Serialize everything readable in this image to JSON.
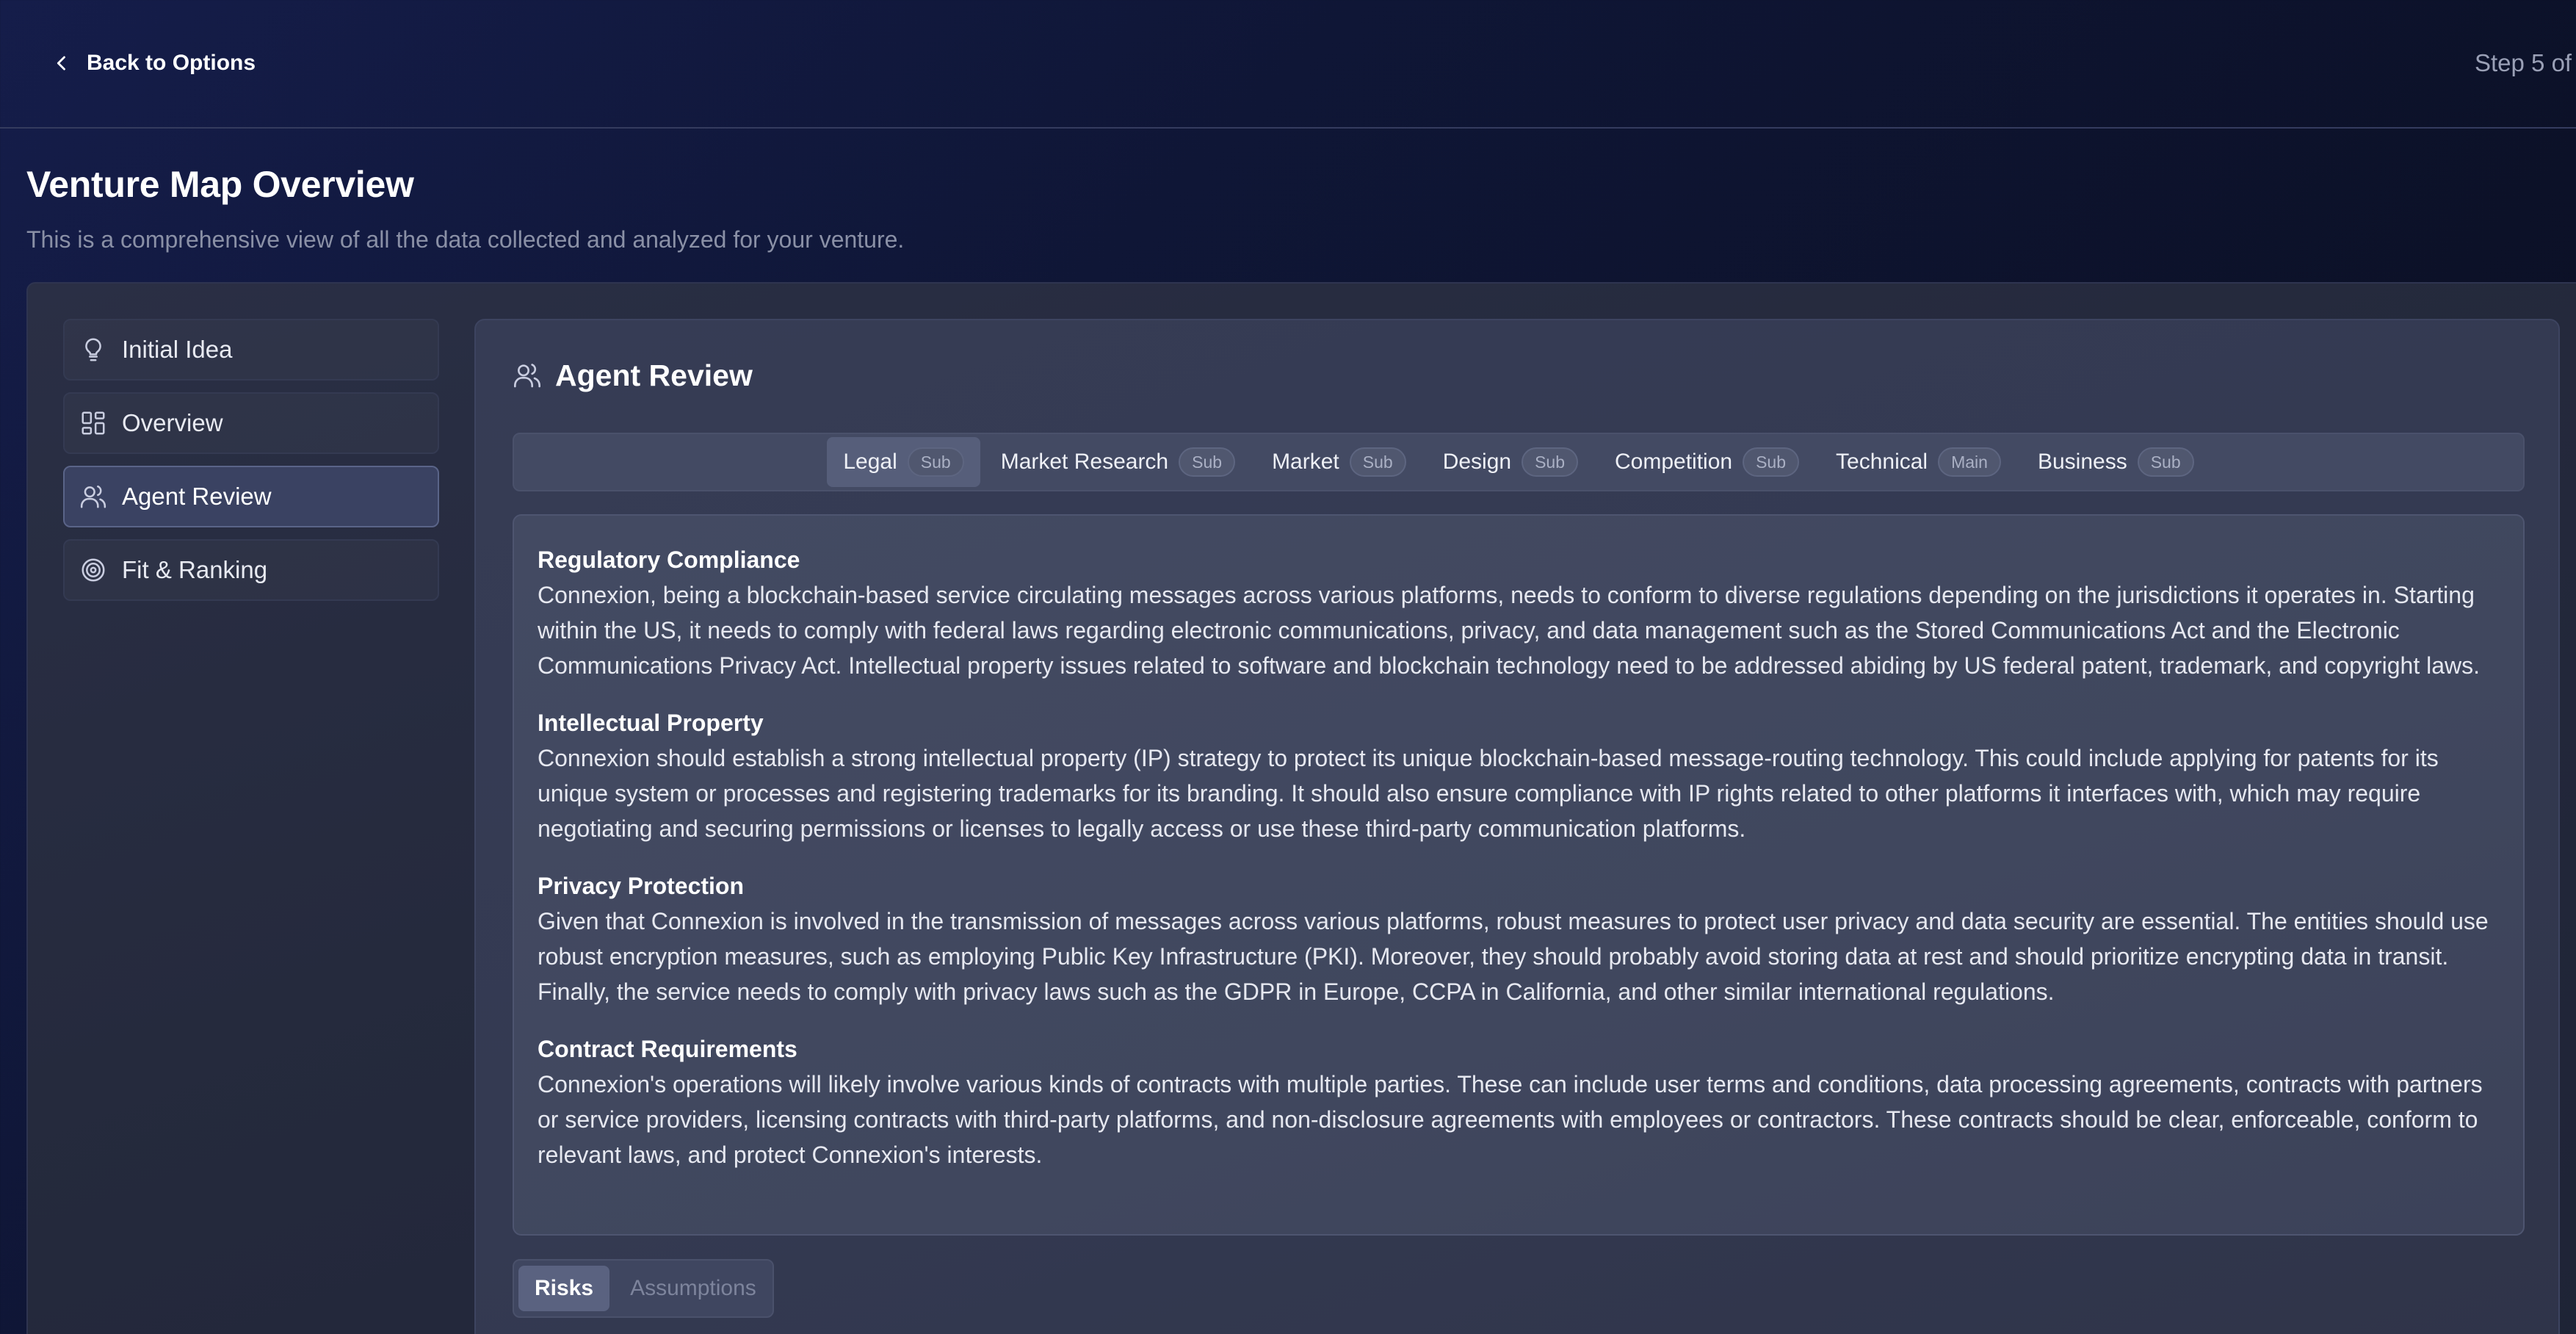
{
  "topbar": {
    "back_label": "Back to Options",
    "step_label": "Step 5 of"
  },
  "page": {
    "title": "Venture Map Overview",
    "subtitle": "This is a comprehensive view of all the data collected and analyzed for your venture."
  },
  "sidebar": {
    "items": [
      {
        "label": "Initial Idea",
        "icon": "lightbulb-icon"
      },
      {
        "label": "Overview",
        "icon": "dashboard-icon"
      },
      {
        "label": "Agent Review",
        "icon": "users-icon",
        "active": true
      },
      {
        "label": "Fit & Ranking",
        "icon": "target-icon"
      }
    ]
  },
  "card": {
    "title": "Agent Review",
    "icon": "users-icon"
  },
  "tabs": [
    {
      "label": "Legal",
      "badge": "Sub",
      "active": true
    },
    {
      "label": "Market Research",
      "badge": "Sub"
    },
    {
      "label": "Market",
      "badge": "Sub"
    },
    {
      "label": "Design",
      "badge": "Sub"
    },
    {
      "label": "Competition",
      "badge": "Sub"
    },
    {
      "label": "Technical",
      "badge": "Main"
    },
    {
      "label": "Business",
      "badge": "Sub"
    }
  ],
  "sections": [
    {
      "title": "Regulatory Compliance",
      "body": "Connexion, being a blockchain-based service circulating messages across various platforms, needs to conform to diverse regulations depending on the jurisdictions it operates in. Starting within the US, it needs to comply with federal laws regarding electronic communications, privacy, and data management such as the Stored Communications Act and the Electronic Communications Privacy Act. Intellectual property issues related to software and blockchain technology need to be addressed abiding by US federal patent, trademark, and copyright laws."
    },
    {
      "title": "Intellectual Property",
      "body": "Connexion should establish a strong intellectual property (IP) strategy to protect its unique blockchain-based message-routing technology. This could include applying for patents for its unique system or processes and registering trademarks for its branding. It should also ensure compliance with IP rights related to other platforms it interfaces with, which may require negotiating and securing permissions or licenses to legally access or use these third-party communication platforms."
    },
    {
      "title": "Privacy Protection",
      "body": "Given that Connexion is involved in the transmission of messages across various platforms, robust measures to protect user privacy and data security are essential. The entities should use robust encryption measures, such as employing Public Key Infrastructure (PKI). Moreover, they should probably avoid storing data at rest and should prioritize encrypting data in transit. Finally, the service needs to comply with privacy laws such as the GDPR in Europe, CCPA in California, and other similar international regulations."
    },
    {
      "title": "Contract Requirements",
      "body": "Connexion's operations will likely involve various kinds of contracts with multiple parties. These can include user terms and conditions, data processing agreements, contracts with partners or service providers, licensing contracts with third-party platforms, and non-disclosure agreements with employees or contractors. These contracts should be clear, enforceable, conform to relevant laws, and protect Connexion's interests."
    }
  ],
  "subtabs": [
    {
      "label": "Risks",
      "active": true
    },
    {
      "label": "Assumptions"
    }
  ],
  "colors": {
    "background": "#0f1636",
    "panel": "#252a3d",
    "card": "#343a52",
    "active_item": "#3a4262"
  }
}
